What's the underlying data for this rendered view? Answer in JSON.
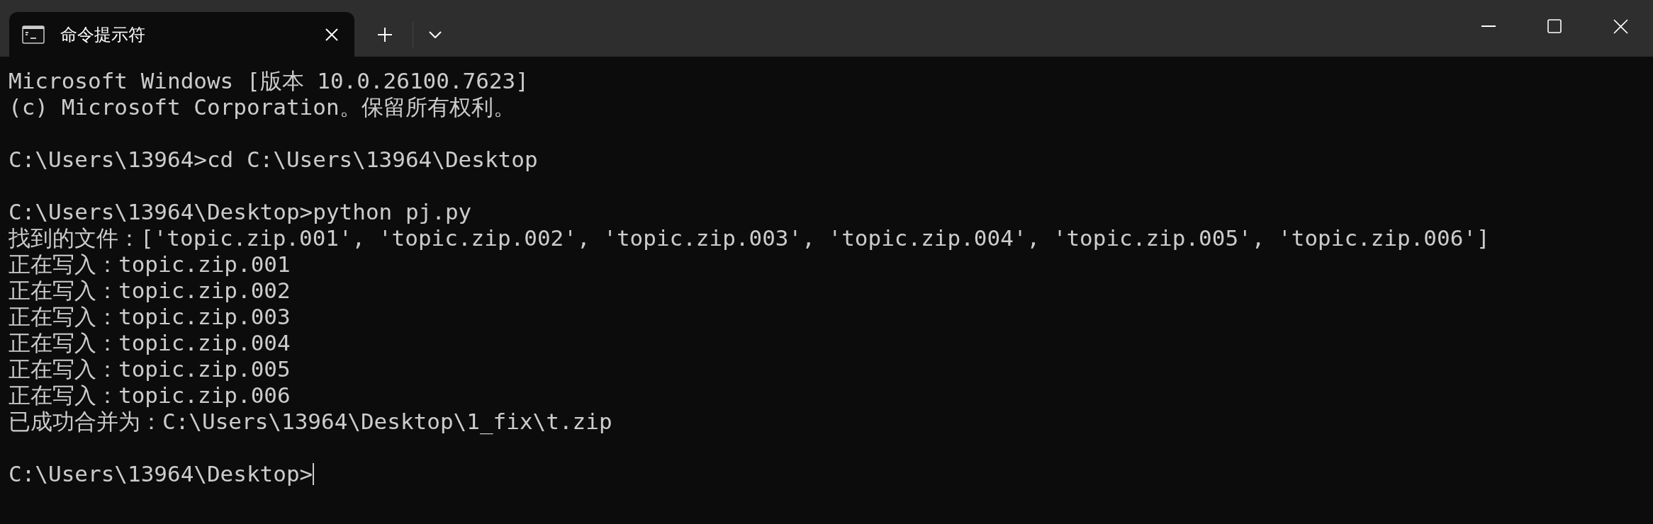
{
  "tab": {
    "title": "命令提示符",
    "selected": true
  },
  "terminal": {
    "lines": [
      {
        "kind": "text",
        "text": "Microsoft Windows [版本 10.0.26100.7623]"
      },
      {
        "kind": "text",
        "text": "(c) Microsoft Corporation。保留所有权利。"
      },
      {
        "kind": "blank"
      },
      {
        "kind": "text",
        "text": "C:\\Users\\13964>cd C:\\Users\\13964\\Desktop"
      },
      {
        "kind": "blank"
      },
      {
        "kind": "text",
        "text": "C:\\Users\\13964\\Desktop>python pj.py"
      },
      {
        "kind": "text",
        "text": "找到的文件：['topic.zip.001', 'topic.zip.002', 'topic.zip.003', 'topic.zip.004', 'topic.zip.005', 'topic.zip.006']"
      },
      {
        "kind": "text",
        "text": "正在写入：topic.zip.001"
      },
      {
        "kind": "text",
        "text": "正在写入：topic.zip.002"
      },
      {
        "kind": "text",
        "text": "正在写入：topic.zip.003"
      },
      {
        "kind": "text",
        "text": "正在写入：topic.zip.004"
      },
      {
        "kind": "text",
        "text": "正在写入：topic.zip.005"
      },
      {
        "kind": "text",
        "text": "正在写入：topic.zip.006"
      },
      {
        "kind": "text",
        "text": "已成功合并为：C:\\Users\\13964\\Desktop\\1_fix\\t.zip"
      },
      {
        "kind": "blank"
      },
      {
        "kind": "prompt",
        "text": "C:\\Users\\13964\\Desktop>"
      }
    ]
  }
}
